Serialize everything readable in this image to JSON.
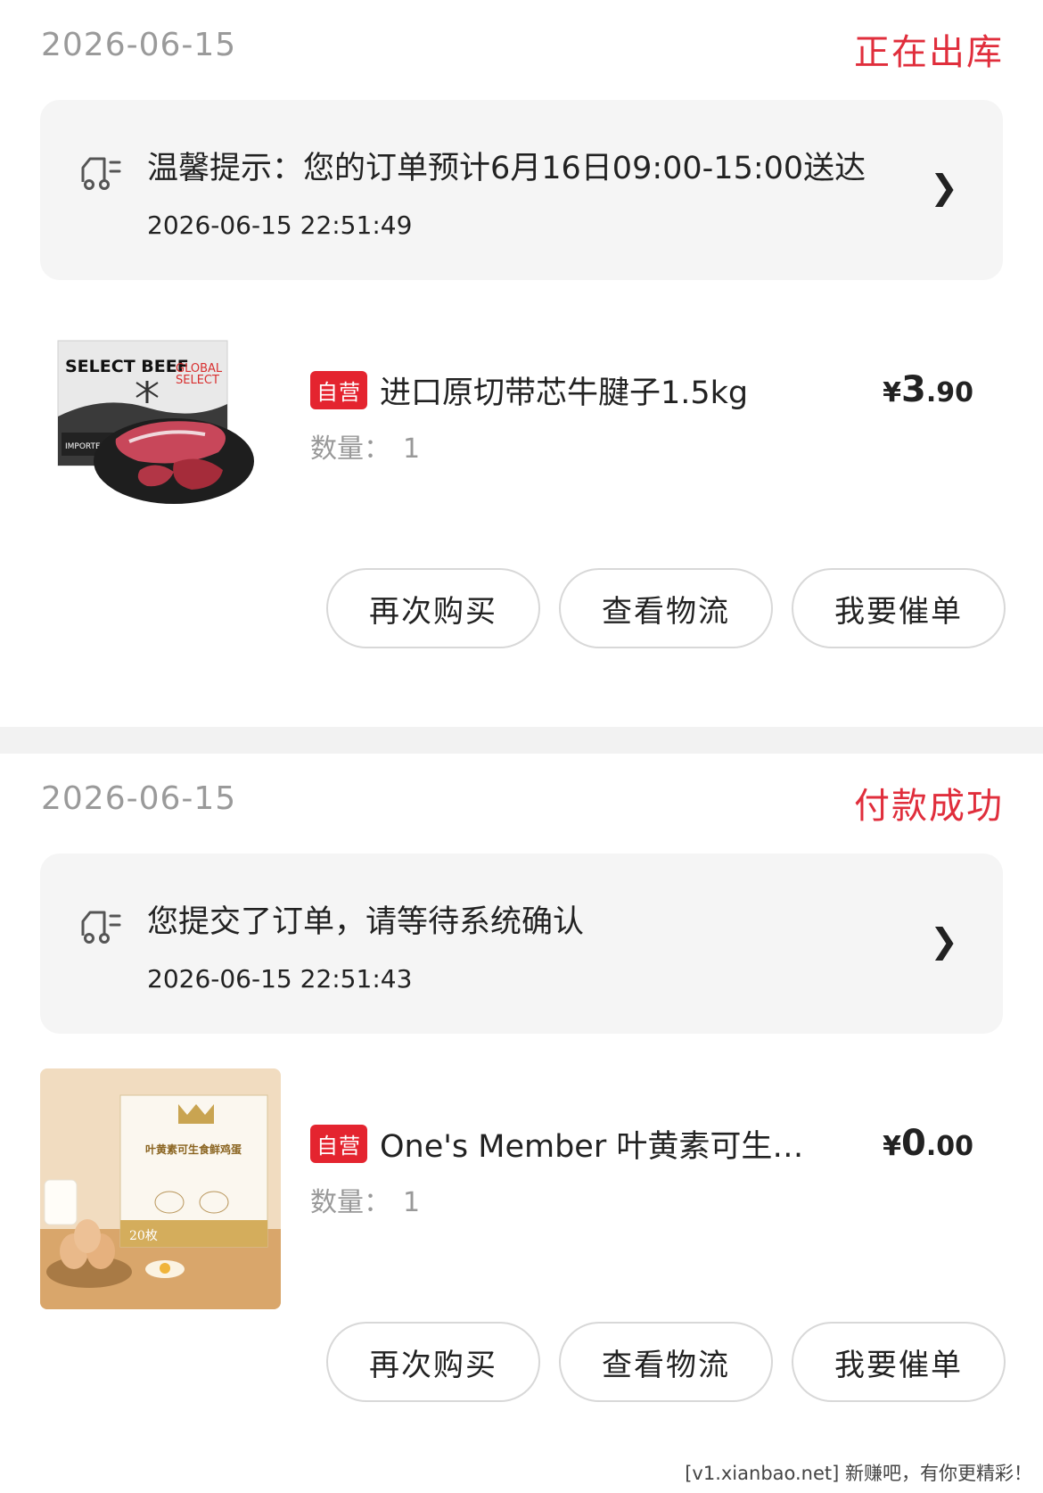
{
  "orders": [
    {
      "date": "2026-06-15",
      "status": "正在出库",
      "notice": {
        "icon": "truck-clock-icon",
        "text": "温馨提示：您的订单预计6月16日09:00-15:00送达",
        "time": "2026-06-15 22:51:49"
      },
      "product": {
        "badge": "自营",
        "name": "进口原切带芯牛腱子1.5kg",
        "qty_label": "数量：",
        "qty": "1",
        "price": {
          "currency": "¥",
          "int": "3",
          "dec": ".90"
        },
        "image": {
          "brand": "SELECT BEEF",
          "sub1": "GLOBAL",
          "sub2": "SELECT",
          "tag": "IMPORTED BEEF"
        }
      },
      "actions": [
        "再次购买",
        "查看物流",
        "我要催单"
      ]
    },
    {
      "date": "2026-06-15",
      "status": "付款成功",
      "notice": {
        "icon": "truck-clock-icon",
        "text": "您提交了订单，请等待系统确认",
        "time": "2026-06-15 22:51:43"
      },
      "product": {
        "badge": "自营",
        "name": "One's Member 叶黄素可生…",
        "qty_label": "数量：",
        "qty": "1",
        "price": {
          "currency": "¥",
          "int": "0",
          "dec": ".00"
        },
        "image": {
          "box_title": "叶黄素可生食鲜鸡蛋",
          "count": "20枚"
        }
      },
      "actions": [
        "再次购买",
        "查看物流",
        "我要催单"
      ]
    }
  ],
  "watermark": "[v1.xianbao.net] 新赚吧，有你更精彩！",
  "colors": {
    "accent": "#e02e3c",
    "badge": "#e4242f",
    "notice_bg": "#f5f5f5"
  }
}
